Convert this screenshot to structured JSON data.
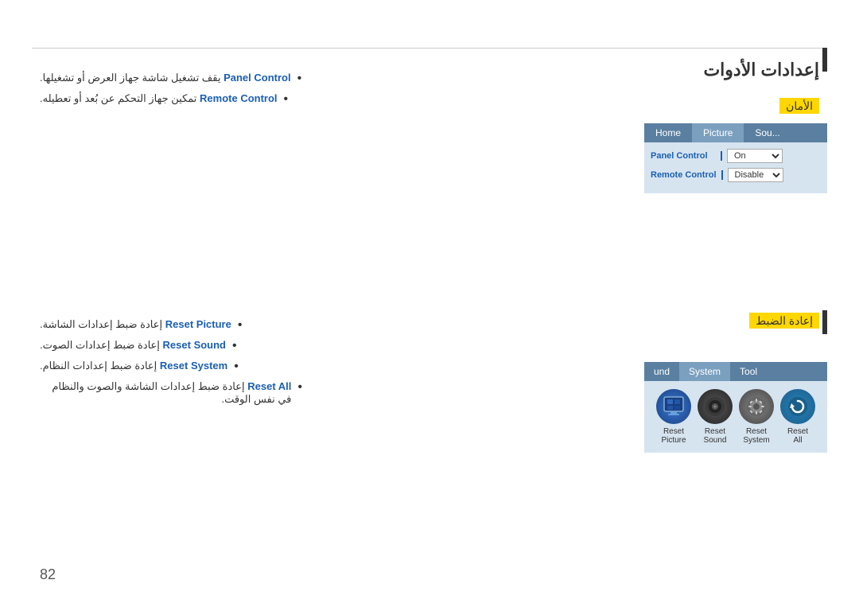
{
  "page": {
    "number": "82",
    "top_line": true
  },
  "main_title": "إعدادات الأدوات",
  "security_section": {
    "badge": "الأمان",
    "bullets": [
      {
        "link": "Panel Control",
        "text": " يقف تشغيل شاشة جهاز العرض أو تشغيلها."
      },
      {
        "link": "Remote Control",
        "text": " تمكين جهاز التحكم عن بُعد أو تعطيله."
      }
    ],
    "ui": {
      "tabs": [
        "Home",
        "Picture",
        "Sou..."
      ],
      "rows": [
        {
          "label": "Panel Control",
          "value": "On"
        },
        {
          "label": "Remote Control",
          "value": "Disable"
        }
      ]
    }
  },
  "reset_section": {
    "badge": "إعادة الضبط",
    "bullets": [
      {
        "link": "Reset Picture",
        "text": " إعادة ضبط إعدادات الشاشة."
      },
      {
        "link": "Reset Sound",
        "text": " إعادة ضبط إعدادات الصوت."
      },
      {
        "link": "Reset System",
        "text": " إعادة ضبط إعدادات النظام."
      },
      {
        "link": "Reset All",
        "text": " إعادة ضبط إعدادات الشاشة والصوت والنظام في نفس الوقت."
      }
    ],
    "ui": {
      "tabs": [
        "und",
        "System",
        "Tool"
      ],
      "items": [
        {
          "label_line1": "Reset",
          "label_line2": "Picture",
          "icon": "🖥"
        },
        {
          "label_line1": "Reset",
          "label_line2": "Sound",
          "icon": "🔊"
        },
        {
          "label_line1": "Reset",
          "label_line2": "System",
          "icon": "⚙"
        },
        {
          "label_line1": "Reset",
          "label_line2": "All",
          "icon": "↺"
        }
      ]
    }
  }
}
